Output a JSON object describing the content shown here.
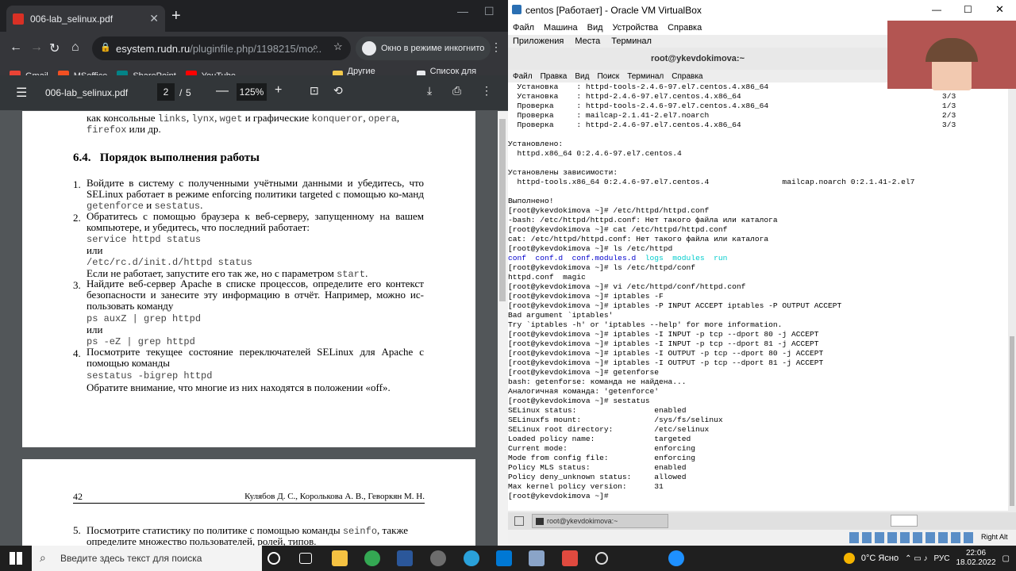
{
  "browser": {
    "tab_title": "006-lab_selinux.pdf",
    "url_host": "esystem.rudn.ru",
    "url_rest": "/pluginfile.php/1198215/mo...",
    "incognito": "Окно в режиме инкогнито",
    "bookmarks": [
      {
        "label": "Gmail",
        "color": "#ea4335"
      },
      {
        "label": "MSoffice",
        "color": "#f25022"
      },
      {
        "label": "SharePoint",
        "color": "#038387"
      },
      {
        "label": "YouTube",
        "color": "#ff0000"
      }
    ],
    "other_bookmarks": "Другие закладки",
    "reading_list": "Список для чтения"
  },
  "pdf": {
    "filename": "006-lab_selinux.pdf",
    "page": "2",
    "pages": "5",
    "zoom": "125%",
    "top_line_pre": "как консольные ",
    "top_line_mono1": "links",
    "top_line_mono2": "lynx",
    "top_line_mono3": "wget",
    "top_line_mid": " и графические ",
    "top_line_mono4": "konqueror",
    "top_line_mono5": "opera",
    "top_line2_mono": "firefox",
    "top_line2_rest": " или др.",
    "section_num": "6.4.",
    "section_title": "Порядок выполнения работы",
    "item1": "Войдите в систему с полученными учётными данными и убедитесь, что SELinux работает в режиме enforcing политики targeted с помощью ко-манд",
    "item1_cmd1": "getenforce",
    "item1_and": " и ",
    "item1_cmd2": "sestatus",
    "item2": "Обратитесь с помощью браузера к веб-серверу, запущенному на вашем компьютере, и убедитесь, что последний работает:",
    "item2_cmd1": "service httpd status",
    "or": "или",
    "item2_cmd2": "/etc/rc.d/init.d/httpd status",
    "item2_note": "Если не работает, запустите его так же, но с параметром",
    "item2_start": "start",
    "item3": "Найдите веб-сервер Apache в списке процессов, определите его контекст безопасности и занесите эту информацию в отчёт. Например, можно ис-пользовать команду",
    "item3_cmd1": "ps auxZ | grep httpd",
    "item3_cmd2": "ps -eZ | grep httpd",
    "item4": "Посмотрите текущее состояние переключателей SELinux для Apache с помощью команды",
    "item4_cmd": "sestatus -bigrep httpd",
    "item4_note": "Обратите внимание, что многие из них находятся в положении «off».",
    "page_num": "42",
    "authors": "Кулябов Д. С., Королькова А. В., Геворкян М. Н.",
    "item5_a": "Посмотрите статистику по политике с помощью команды",
    "item5_cmd": "seinfo",
    "item5_b": ", также",
    "item5_c": "определите множество пользователей, ролей, типов."
  },
  "vbox": {
    "title": "centos [Работает] - Oracle VM VirtualBox",
    "menu": [
      "Файл",
      "Машина",
      "Вид",
      "Устройства",
      "Справка"
    ],
    "gnome": [
      "Приложения",
      "Места",
      "Терминал"
    ],
    "term_title": "root@ykevdokimova:~",
    "term_menu": [
      "Файл",
      "Правка",
      "Вид",
      "Поиск",
      "Терминал",
      "Справка"
    ],
    "task_label": "root@ykevdokimova:~",
    "host_key": "Right Alt",
    "lines": [
      "  Установка    : httpd-tools-2.4.6-97.el7.centos.4.x86_64                                      3/3",
      "  Установка    : httpd-2.4.6-97.el7.centos.4.x86_64                                            3/3",
      "  Проверка     : httpd-tools-2.4.6-97.el7.centos.4.x86_64                                      1/3",
      "  Проверка     : mailcap-2.1.41-2.el7.noarch                                                   2/3",
      "  Проверка     : httpd-2.4.6-97.el7.centos.4.x86_64                                            3/3",
      "",
      "Установлено:",
      "  httpd.x86_64 0:2.4.6-97.el7.centos.4",
      "",
      "Установлены зависимости:",
      "  httpd-tools.x86_64 0:2.4.6-97.el7.centos.4                mailcap.noarch 0:2.1.41-2.el7",
      "",
      "Выполнено!",
      "[root@ykevdokimova ~]# /etc/httpd/httpd.conf",
      "-bash: /etc/httpd/httpd.conf: Нет такого файла или каталога",
      "[root@ykevdokimova ~]# cat /etc/httpd/httpd.conf",
      "cat: /etc/httpd/httpd.conf: Нет такого файла или каталога",
      "[root@ykevdokimova ~]# ls /etc/httpd",
      "LS_DIRS",
      "[root@ykevdokimova ~]# ls /etc/httpd/conf",
      "httpd.conf  magic",
      "[root@ykevdokimova ~]# vi /etc/httpd/conf/httpd.conf",
      "[root@ykevdokimova ~]# iptables -F",
      "[root@ykevdokimova ~]# iptables -P INPUT ACCEPT iptables -P OUTPUT ACCEPT",
      "Bad argument `iptables'",
      "Try `iptables -h' or 'iptables --help' for more information.",
      "[root@ykevdokimova ~]# iptables -I INPUT -p tcp --dport 80 -j ACCEPT",
      "[root@ykevdokimova ~]# iptables -I INPUT -p tcp --dport 81 -j ACCEPT",
      "[root@ykevdokimova ~]# iptables -I OUTPUT -p tcp --dport 80 -j ACCEPT",
      "[root@ykevdokimova ~]# iptables -I OUTPUT -p tcp --dport 81 -j ACCEPT",
      "[root@ykevdokimova ~]# getenforse",
      "bash: getenforse: команда не найдена...",
      "Аналогичная команда: 'getenforce'",
      "[root@ykevdokimova ~]# sestatus",
      "SELinux status:                 enabled",
      "SELinuxfs mount:                /sys/fs/selinux",
      "SELinux root directory:         /etc/selinux",
      "Loaded policy name:             targeted",
      "Current mode:                   enforcing",
      "Mode from config file:          enforcing",
      "Policy MLS status:              enabled",
      "Policy deny_unknown status:     allowed",
      "Max kernel policy version:      31",
      "[root@ykevdokimova ~]# "
    ],
    "ls_dirs": [
      {
        "t": "conf",
        "c": "#0000cc"
      },
      {
        "t": "conf.d",
        "c": "#0000cc"
      },
      {
        "t": "conf.modules.d",
        "c": "#0000cc"
      },
      {
        "t": "logs",
        "c": "#00cccc"
      },
      {
        "t": "modules",
        "c": "#00cccc"
      },
      {
        "t": "run",
        "c": "#00cccc"
      }
    ]
  },
  "taskbar": {
    "search": "Введите здесь текст для поиска",
    "weather": "0°C Ясно",
    "lang": "РУС",
    "time": "22:06",
    "date": "18.02.2022"
  }
}
